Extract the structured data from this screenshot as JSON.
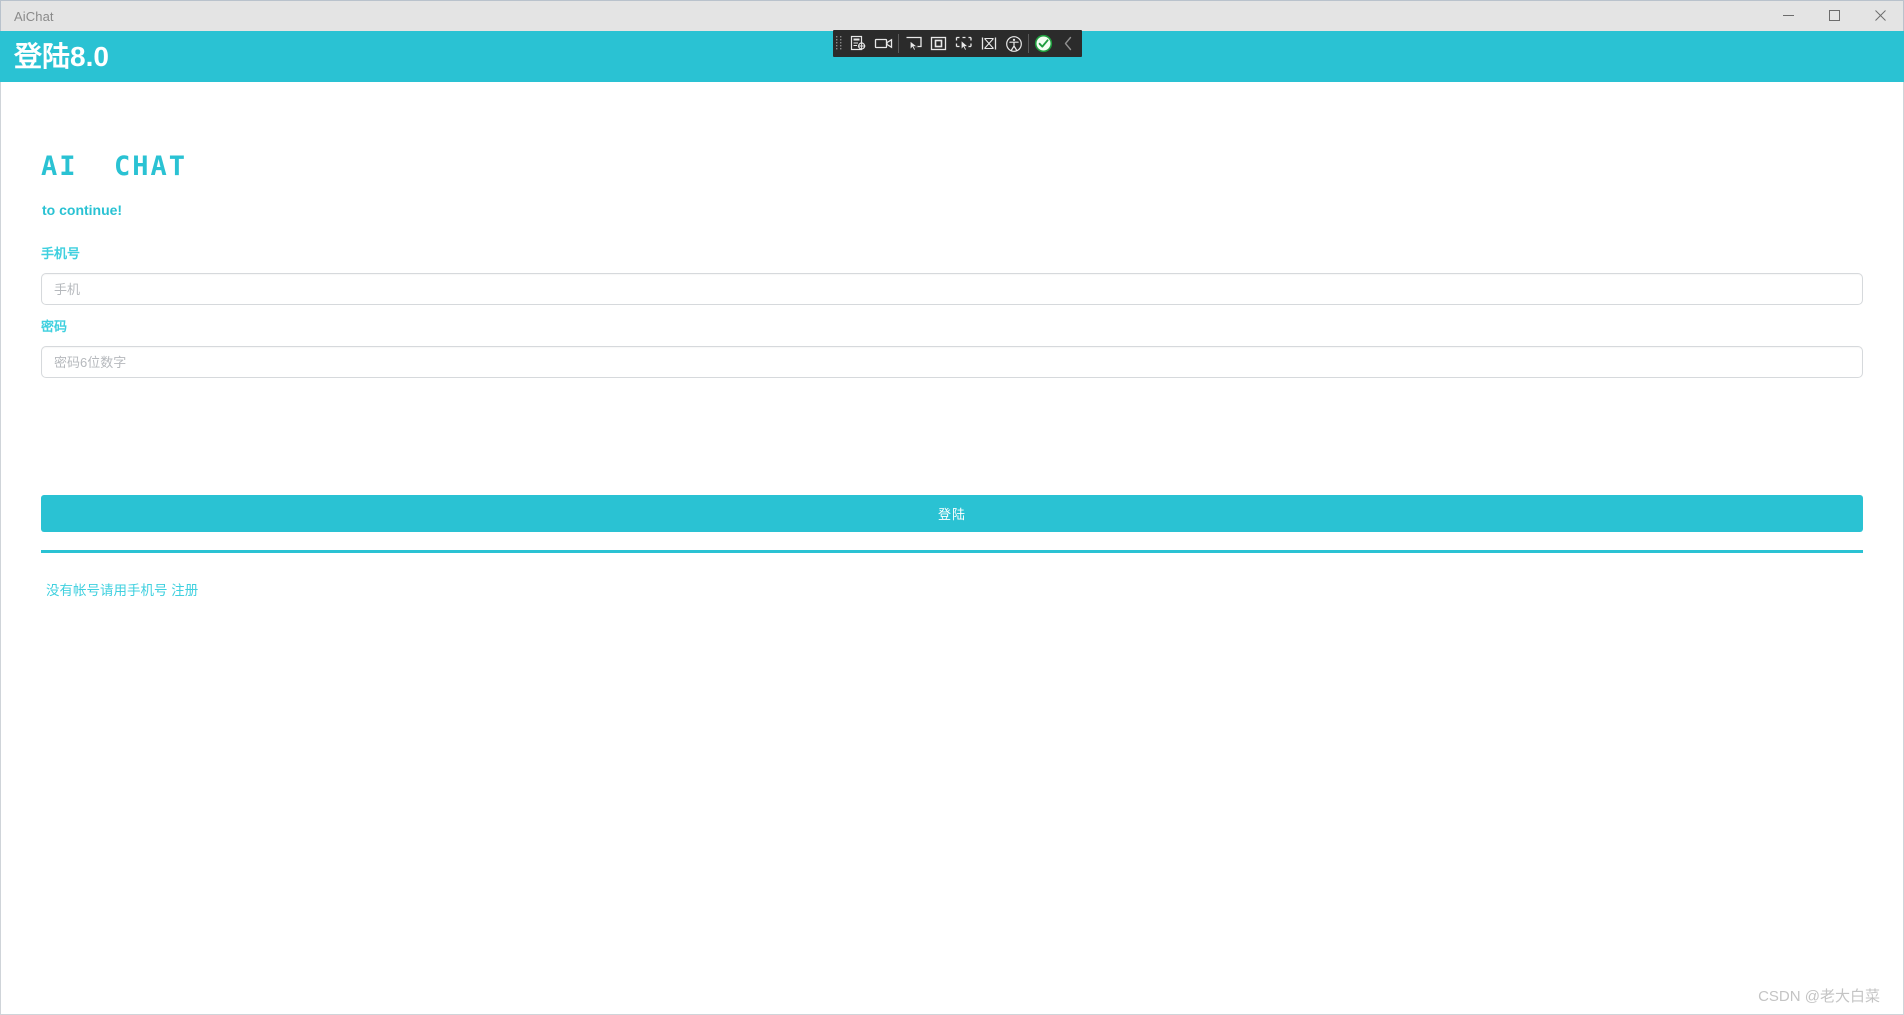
{
  "window": {
    "title": "AiChat",
    "controls": [
      {
        "name": "minimize",
        "glyph": "minimize-icon"
      },
      {
        "name": "maximize",
        "glyph": "maximize-icon"
      },
      {
        "name": "close",
        "glyph": "close-icon"
      }
    ]
  },
  "app_header": {
    "title": "登陆8.0",
    "background": "#2ac2d3"
  },
  "automation_toolbar": {
    "background": "#2b2b2b",
    "items": [
      {
        "name": "drag-grip",
        "icon": "grip-dots-icon"
      },
      {
        "name": "inspect-element",
        "icon": "document-target-icon"
      },
      {
        "name": "record-video",
        "icon": "video-camera-icon"
      },
      {
        "name": "select-cursor",
        "icon": "cursor-select-icon"
      },
      {
        "name": "select-region",
        "icon": "square-region-icon"
      },
      {
        "name": "pick-element",
        "icon": "element-picker-icon"
      },
      {
        "name": "highlight-overlap",
        "icon": "overlap-shapes-icon"
      },
      {
        "name": "accessibility",
        "icon": "accessibility-person-icon"
      },
      {
        "name": "validate-status",
        "icon": "green-check-circle-icon"
      },
      {
        "name": "collapse-toolbar",
        "icon": "chevron-left-icon"
      }
    ]
  },
  "form": {
    "brand": "AI  CHAT",
    "subtitle": "to continue!",
    "phone": {
      "label": "手机号",
      "placeholder": "手机",
      "value": ""
    },
    "password": {
      "label": "密码",
      "placeholder": "密码6位数字",
      "value": ""
    },
    "submit_label": "登陆",
    "register": {
      "prefix": "没有帐号请用手机号 ",
      "link": "注册"
    }
  },
  "colors": {
    "accent": "#2ac2d3",
    "label": "#3fd0df",
    "placeholder": "#b6b9bd",
    "watermark": "#c4c4c4"
  },
  "watermark": "CSDN @老大白菜"
}
